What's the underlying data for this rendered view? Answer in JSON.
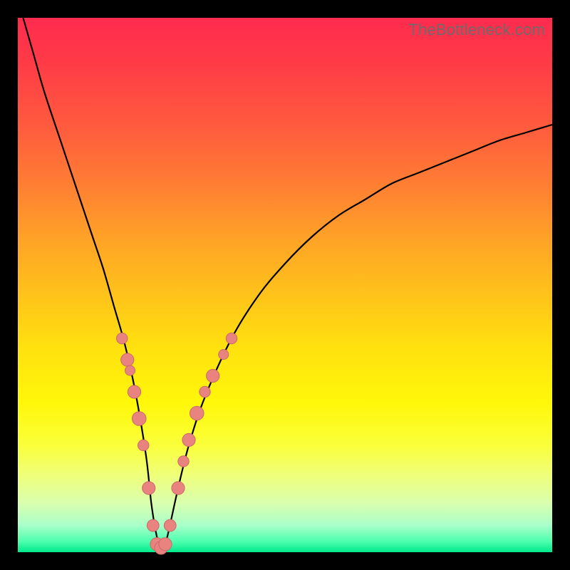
{
  "watermark": "TheBottleneck.com",
  "colors": {
    "frame": "#000000",
    "gradient_top": "#ff2b4e",
    "gradient_bottom": "#00e98c",
    "curve": "#000000",
    "annotation": "#e9837f"
  },
  "chart_data": {
    "type": "line",
    "title": "",
    "xlabel": "",
    "ylabel": "",
    "xlim": [
      0,
      100
    ],
    "ylim": [
      0,
      100
    ],
    "grid": false,
    "legend": false,
    "series": [
      {
        "name": "bottleneck-curve",
        "x": [
          1,
          3,
          5,
          8,
          10,
          12,
          14,
          16,
          18,
          20,
          22,
          24,
          25,
          26,
          27,
          28,
          30,
          32,
          35,
          40,
          45,
          50,
          55,
          60,
          65,
          70,
          75,
          80,
          85,
          90,
          95,
          100
        ],
        "y": [
          100,
          93,
          86,
          77,
          71,
          65,
          59,
          53,
          46,
          39,
          30,
          18,
          9,
          3,
          0,
          3,
          12,
          20,
          29,
          40,
          48,
          54,
          59,
          63,
          66,
          69,
          71,
          73,
          75,
          77,
          78.5,
          80
        ]
      }
    ],
    "annotations": {
      "type": "points",
      "description": "salmon bead markers clustered near the minimum on both branches",
      "points": [
        {
          "x": 19.5,
          "y": 40,
          "r": 1.1
        },
        {
          "x": 20.5,
          "y": 36,
          "r": 1.3
        },
        {
          "x": 21.0,
          "y": 34,
          "r": 1.0
        },
        {
          "x": 21.8,
          "y": 30,
          "r": 1.3
        },
        {
          "x": 22.7,
          "y": 25,
          "r": 1.4
        },
        {
          "x": 23.5,
          "y": 20,
          "r": 1.1
        },
        {
          "x": 24.5,
          "y": 12,
          "r": 1.3
        },
        {
          "x": 25.3,
          "y": 5,
          "r": 1.2
        },
        {
          "x": 26.0,
          "y": 1.5,
          "r": 1.3
        },
        {
          "x": 26.8,
          "y": 0.8,
          "r": 1.3
        },
        {
          "x": 27.6,
          "y": 1.5,
          "r": 1.3
        },
        {
          "x": 28.5,
          "y": 5,
          "r": 1.2
        },
        {
          "x": 30.0,
          "y": 12,
          "r": 1.3
        },
        {
          "x": 31.0,
          "y": 17,
          "r": 1.1
        },
        {
          "x": 32.0,
          "y": 21,
          "r": 1.3
        },
        {
          "x": 33.5,
          "y": 26,
          "r": 1.4
        },
        {
          "x": 35.0,
          "y": 30,
          "r": 1.1
        },
        {
          "x": 36.5,
          "y": 33,
          "r": 1.3
        },
        {
          "x": 38.5,
          "y": 37,
          "r": 1.0
        },
        {
          "x": 40.0,
          "y": 40,
          "r": 1.1
        }
      ]
    }
  }
}
